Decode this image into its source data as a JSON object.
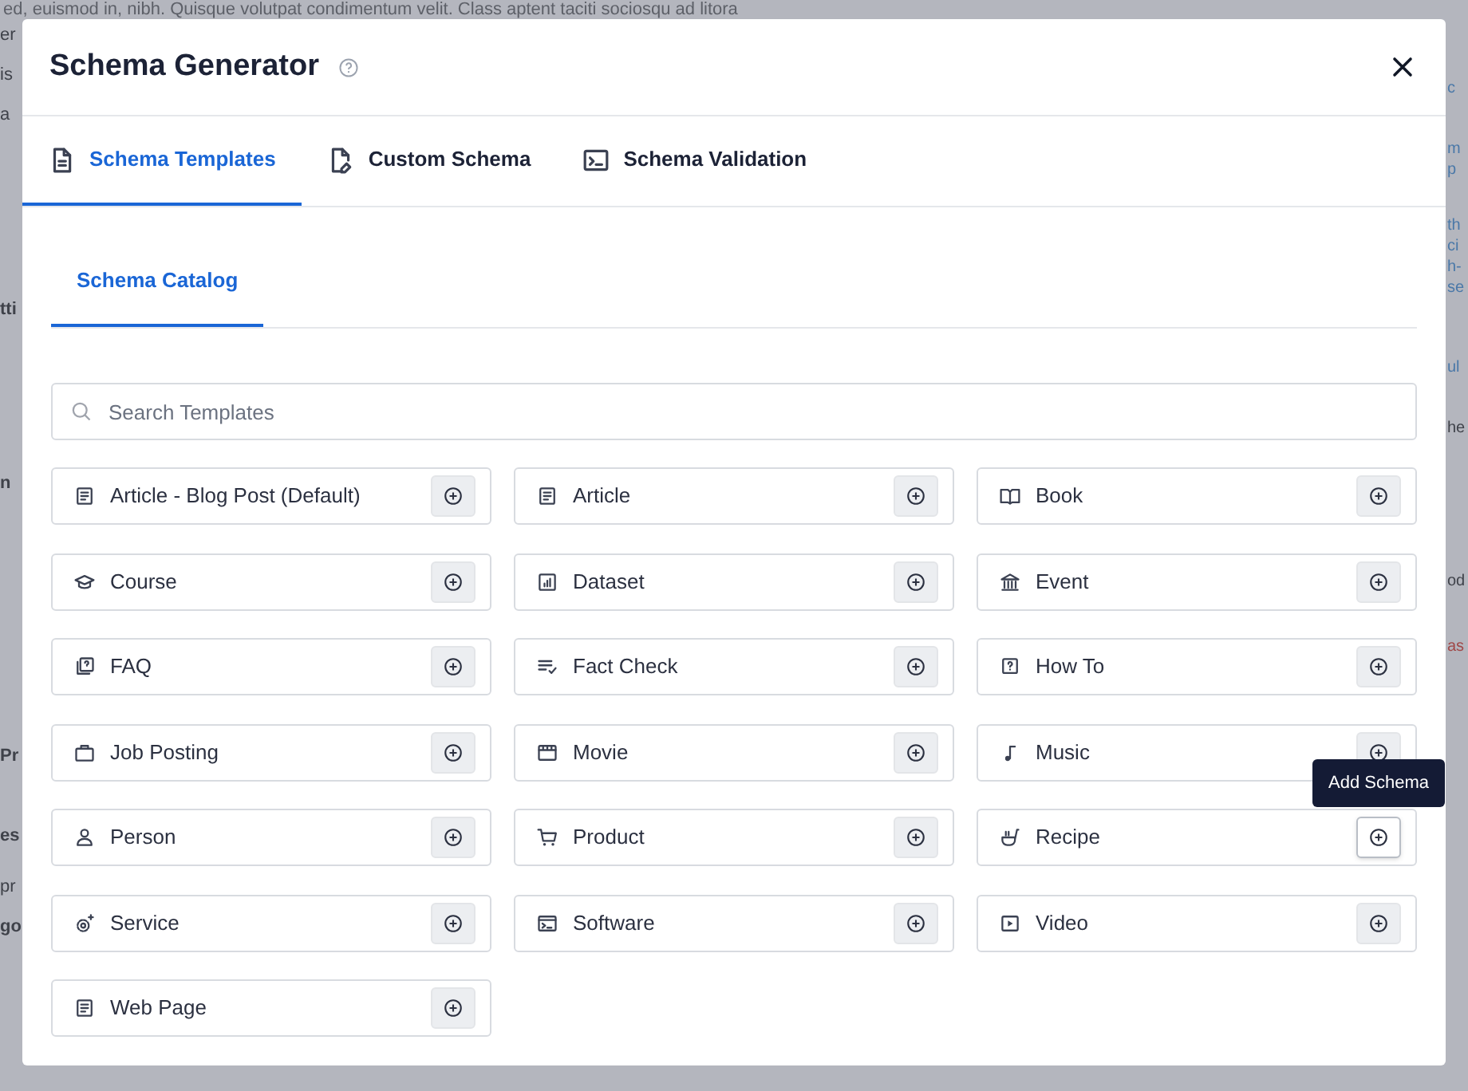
{
  "background": {
    "top_line": "ed, euismod in, nibh. Quisque volutpat condimentum velit. Class aptent taciti sociosqu ad litora",
    "left_fragments": [
      "er",
      "is",
      "a",
      "tti",
      "n",
      "Pr",
      "es",
      "pr",
      "go"
    ],
    "right_fragments": [
      "c",
      "m",
      "p",
      "th",
      "ci",
      "h-",
      "se",
      "ul",
      "he",
      "od",
      "as"
    ]
  },
  "dialog": {
    "title": "Schema Generator",
    "tabs": [
      {
        "label": "Schema Templates",
        "selected": true
      },
      {
        "label": "Custom Schema",
        "selected": false
      },
      {
        "label": "Schema Validation",
        "selected": false
      }
    ],
    "subtabs": [
      {
        "label": "Schema Catalog",
        "selected": true
      }
    ],
    "search": {
      "placeholder": "Search Templates"
    },
    "templates": [
      {
        "label": "Article - Blog Post (Default)",
        "hovered": false
      },
      {
        "label": "Article",
        "hovered": false
      },
      {
        "label": "Book",
        "hovered": false
      },
      {
        "label": "Course",
        "hovered": false
      },
      {
        "label": "Dataset",
        "hovered": false
      },
      {
        "label": "Event",
        "hovered": false
      },
      {
        "label": "FAQ",
        "hovered": false
      },
      {
        "label": "Fact Check",
        "hovered": false
      },
      {
        "label": "How To",
        "hovered": false
      },
      {
        "label": "Job Posting",
        "hovered": false
      },
      {
        "label": "Movie",
        "hovered": false
      },
      {
        "label": "Music",
        "hovered": false
      },
      {
        "label": "Person",
        "hovered": false
      },
      {
        "label": "Product",
        "hovered": false
      },
      {
        "label": "Recipe",
        "hovered": true
      },
      {
        "label": "Service",
        "hovered": false
      },
      {
        "label": "Software",
        "hovered": false
      },
      {
        "label": "Video",
        "hovered": false
      },
      {
        "label": "Web Page",
        "hovered": false
      }
    ],
    "tooltip": "Add Schema"
  }
}
